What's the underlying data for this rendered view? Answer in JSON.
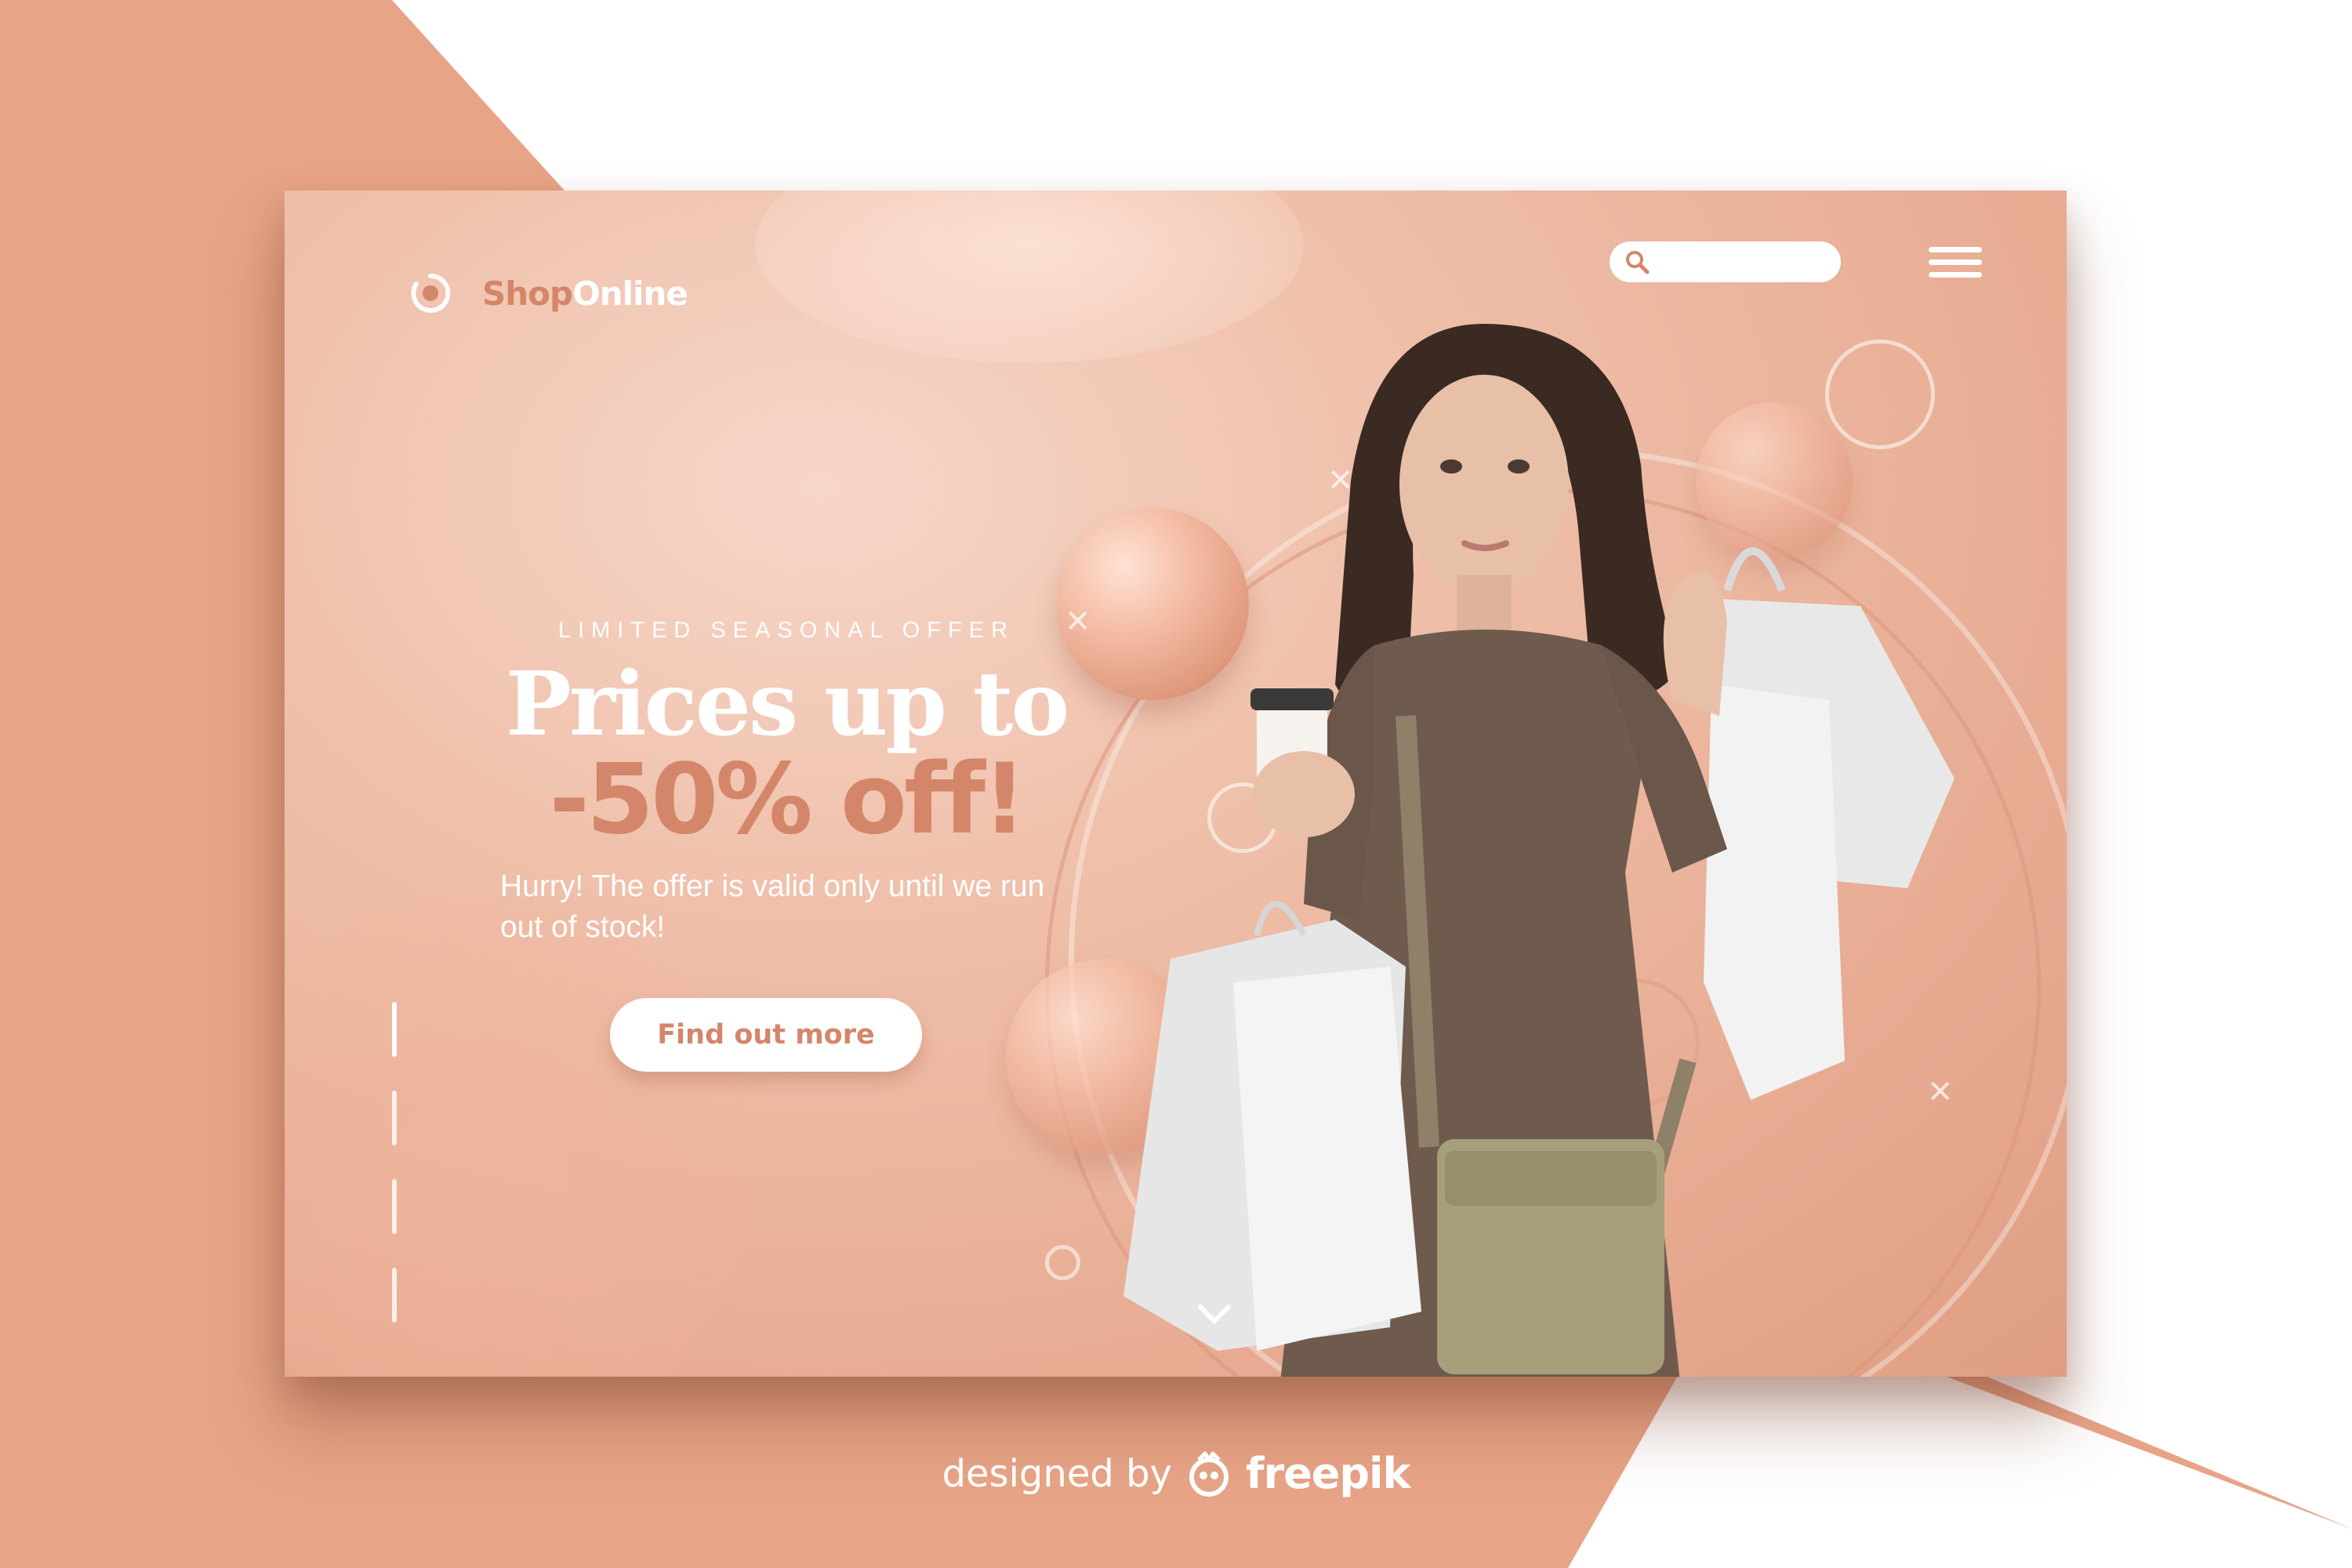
{
  "colors": {
    "background": "#e7a487",
    "accent": "#d4866a",
    "white": "#ffffff"
  },
  "header": {
    "logo": {
      "part1": "Shop",
      "part2": "Online"
    },
    "search_placeholder": "",
    "menu_icon": "hamburger-menu-icon",
    "search_icon": "search-icon"
  },
  "hero": {
    "eyebrow": "LIMITED SEASONAL OFFER",
    "headline_line1": "Prices up to",
    "headline_line2": "-50% off!",
    "subtext": "Hurry! The offer is valid only until we run out of stock!",
    "cta_label": "Find out more"
  },
  "slider": {
    "count": 4,
    "active_index": 0
  },
  "footer": {
    "by_text": "designed by",
    "brand": "freepik"
  }
}
